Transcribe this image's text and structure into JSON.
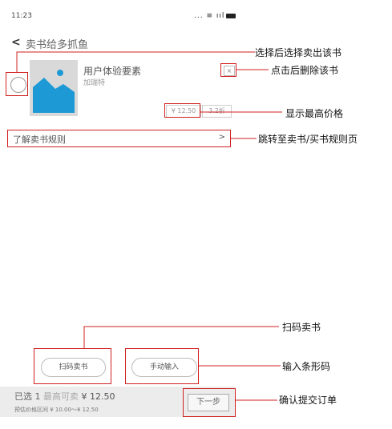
{
  "status_bar": {
    "time": "11:23",
    "signal_text": "... ≡ ııl"
  },
  "nav": {
    "back_label": "<",
    "title": "卖书给多抓鱼"
  },
  "book": {
    "title": "用户体验要素",
    "author": "加瑞特",
    "delete_label": "×",
    "price": "¥ 12.50",
    "discount": "3.2折"
  },
  "rules": {
    "label": "了解卖书规则",
    "arrow": ">"
  },
  "actions": {
    "scan_label": "扫码卖书",
    "manual_label": "手动输入"
  },
  "bottom": {
    "selected_prefix": "已选",
    "selected_count": "1",
    "max_label": "最高可卖",
    "max_price": "¥ 12.50",
    "range_label": "预估价格区间",
    "range_value": "¥ 10.00～¥ 12.50",
    "next_label": "下一步"
  },
  "annotations": {
    "select": "选择后选择卖出该书",
    "delete": "点击后删除该书",
    "highest_price": "显示最高价格",
    "rules_jump": "跳转至卖书/买书规则页",
    "scan": "扫码卖书",
    "barcode": "输入条形码",
    "confirm": "确认提交订单"
  },
  "colors": {
    "annotation_red": "#d02020",
    "cover_blue": "#1d9ad6",
    "bottom_bar": "#ececec"
  }
}
